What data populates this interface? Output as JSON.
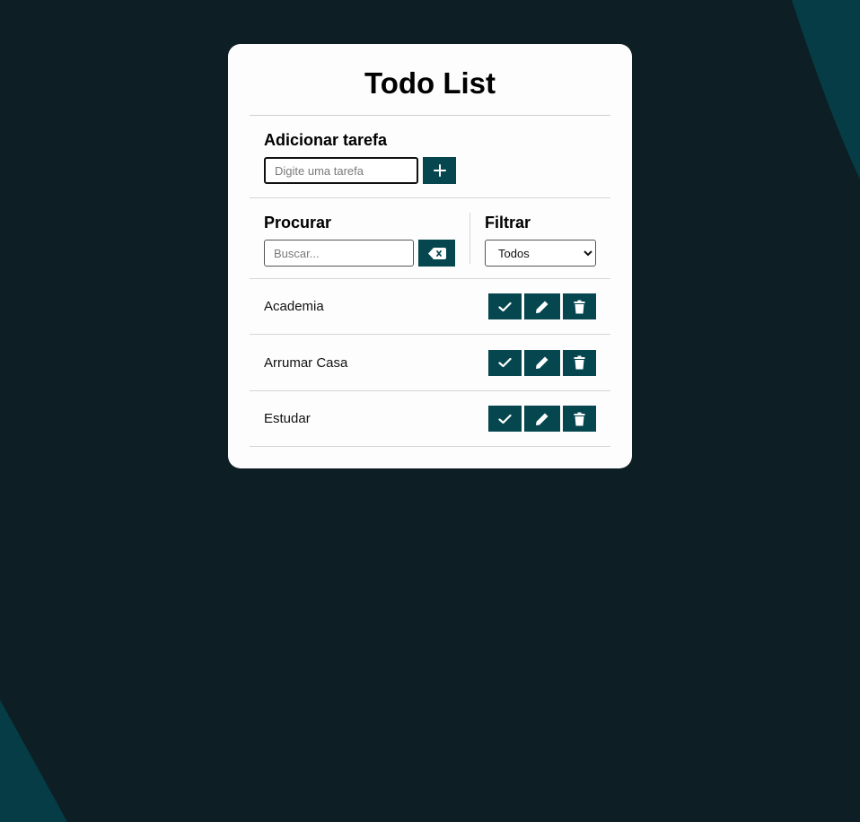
{
  "app": {
    "title": "Todo List"
  },
  "add_task": {
    "label": "Adicionar tarefa",
    "input_placeholder": "Digite uma tarefa",
    "input_value": "",
    "add_button_icon": "plus-icon"
  },
  "search": {
    "label": "Procurar",
    "placeholder": "Buscar...",
    "value": "",
    "clear_button_icon": "backspace-icon"
  },
  "filter": {
    "label": "Filtrar",
    "selected": "Todos"
  },
  "todos": [
    {
      "text": "Academia"
    },
    {
      "text": "Arrumar Casa"
    },
    {
      "text": "Estudar"
    }
  ],
  "row_action_icons": [
    "check-icon",
    "pencil-icon",
    "trash-icon"
  ],
  "colors": {
    "background": "#0d1f24",
    "accent_shape": "#053c45",
    "card": "#fdfdfd",
    "button": "#06474f"
  }
}
